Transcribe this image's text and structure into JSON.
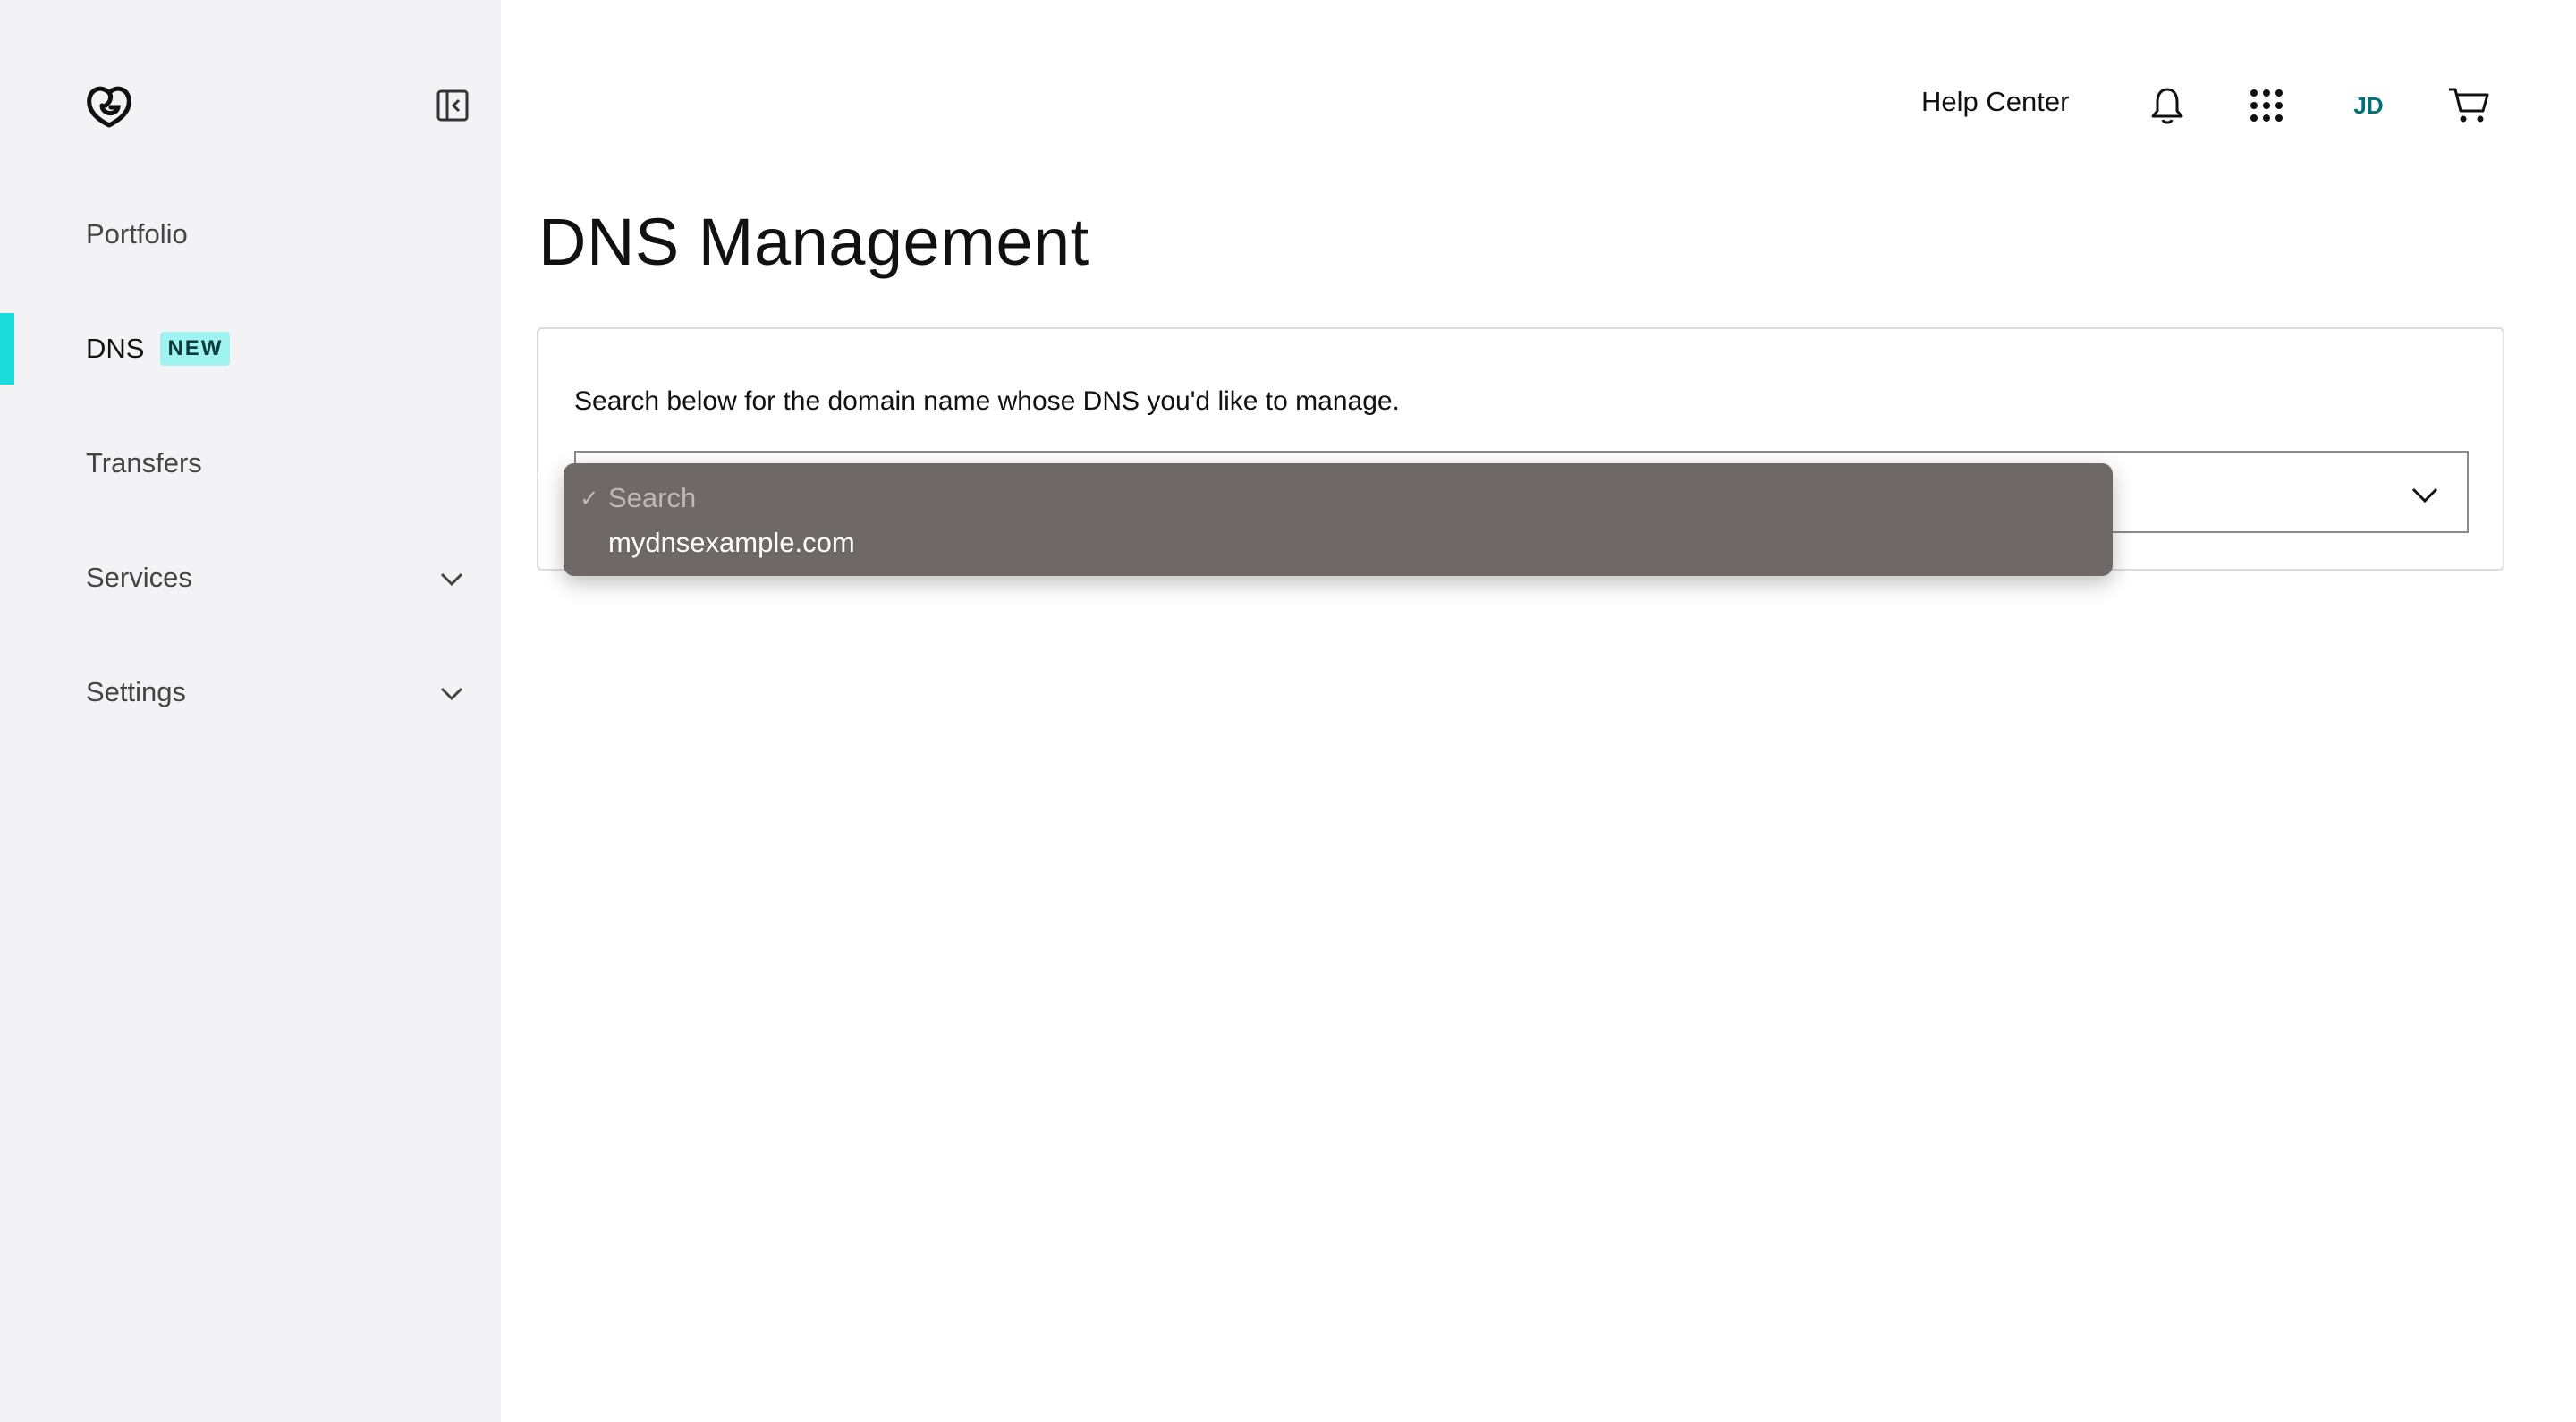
{
  "sidebar": {
    "items": [
      {
        "label": "Portfolio"
      },
      {
        "label": "DNS",
        "badge": "NEW",
        "active": true
      },
      {
        "label": "Transfers"
      },
      {
        "label": "Services",
        "expandable": true
      },
      {
        "label": "Settings",
        "expandable": true
      }
    ]
  },
  "header": {
    "help_label": "Help Center",
    "avatar_initials": "JD"
  },
  "main": {
    "title": "DNS Management",
    "instructions": "Search below for the domain name whose DNS you'd like to manage."
  },
  "dropdown": {
    "options": [
      {
        "label": "Search",
        "selected": true,
        "check": "✓"
      },
      {
        "label": "mydnsexample.com"
      }
    ]
  },
  "colors": {
    "accent": "#1bdbdb",
    "badge_bg": "#9ff4f1",
    "avatar": "#00707a",
    "dropdown_bg": "#6e6966"
  }
}
